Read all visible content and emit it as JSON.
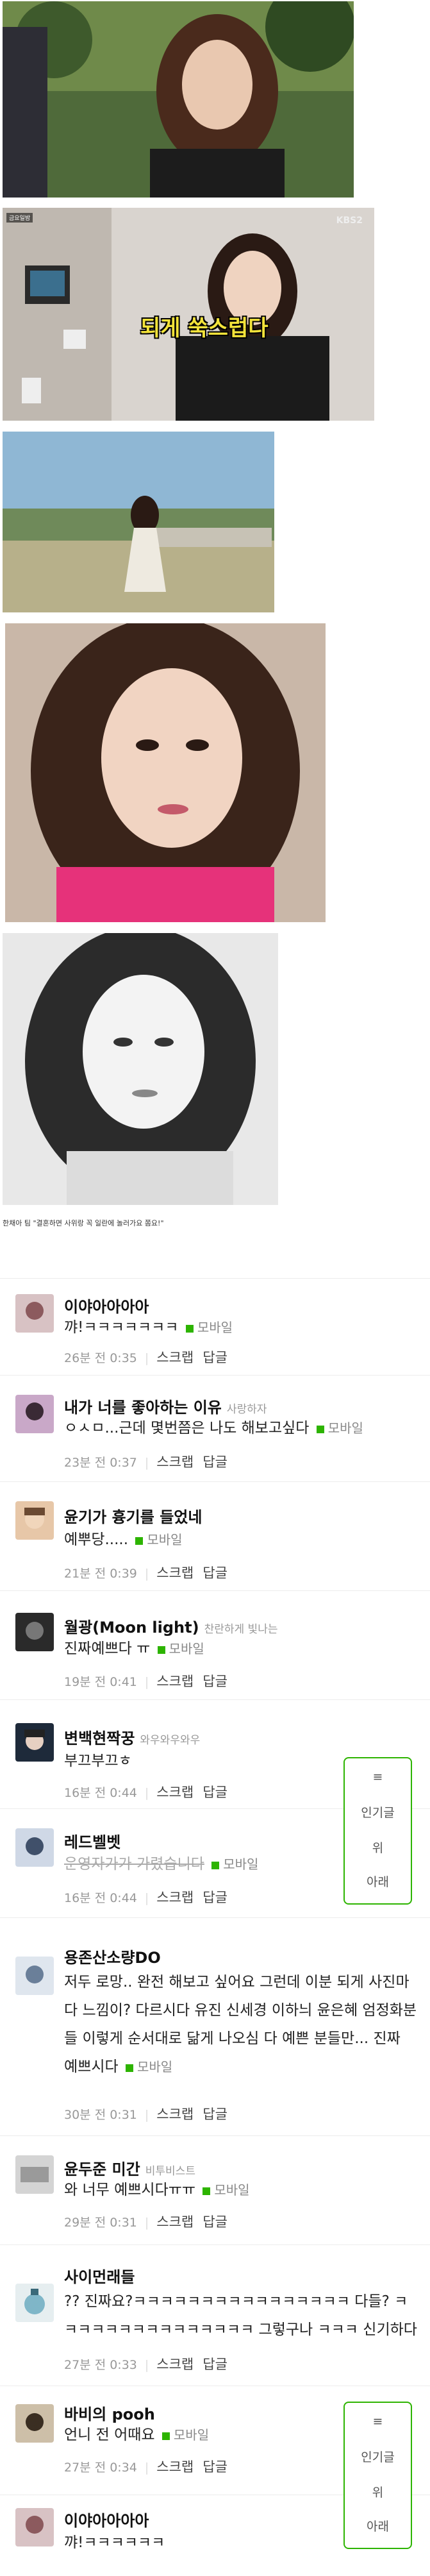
{
  "photos": {
    "kbs_tag": "KBS2",
    "tv_badge": "금요일밤",
    "overlay": "되게 쑥스럽다",
    "caption": "한채아 팀 \"결혼하면 사위랑 꼭 일란에 놀러가요 쫌요!\""
  },
  "comments": [
    {
      "nick": "이야아아아아",
      "sub": "",
      "body": "꺄!ㅋㅋㅋㅋㅋㅋㅋ",
      "mobile": "모바일",
      "time": "26분 전 0:35",
      "scrap": "스크랩",
      "reply": "답글"
    },
    {
      "nick": "내가 너를 좋아하는 이유",
      "sub": "사랑하자",
      "body": "ㅇㅅㅁ...근데 몇번쯤은 나도 해보고싶다",
      "mobile": "모바일",
      "time": "23분 전 0:37",
      "scrap": "스크랩",
      "reply": "답글"
    },
    {
      "nick": "윤기가 흉기를 들었네",
      "sub": "",
      "body": "예뿌당.....",
      "mobile": "모바일",
      "time": "21분 전 0:39",
      "scrap": "스크랩",
      "reply": "답글"
    },
    {
      "nick": "월광(Moon light)",
      "sub": "찬란하게 빛나는",
      "body": "진짜예쁘다 ㅠ",
      "mobile": "모바일",
      "time": "19분 전 0:41",
      "scrap": "스크랩",
      "reply": "답글"
    },
    {
      "nick": "변백현짝꿍",
      "sub": "와우와우와우",
      "body": "부끄부끄ㅎ",
      "mobile": "",
      "time": "16분 전 0:44",
      "scrap": "스크랩",
      "reply": "답글"
    },
    {
      "nick": "레드벨벳",
      "sub": "",
      "body": "운영자가가 가렸습니다",
      "mobile": "모바일",
      "time": "16분 전 0:44",
      "scrap": "스크랩",
      "reply": "답글"
    },
    {
      "nick": "용존산소량DO",
      "sub": "",
      "body": "저두 로망.. 완전 해보고 싶어요 그런데 이분 되게 사진마다 느낌이? 다르시다 유진 신세경 이하늬 윤은혜 엄정화분들 이렇게 순서대로 닮게 나오심 다 예쁜 분들만... 진짜 예쁘시다",
      "mobile": "모바일",
      "time": "30분 전 0:31",
      "scrap": "스크랩",
      "reply": "답글"
    },
    {
      "nick": "윤두준 미간",
      "sub": "비투비스트",
      "body": "와 너무 예쁘시다ㅠㅠ",
      "mobile": "모바일",
      "time": "29분 전 0:31",
      "scrap": "스크랩",
      "reply": "답글"
    },
    {
      "nick": "사이먼래들",
      "sub": "",
      "body": "?? 진짜요?ㅋㅋㅋㅋㅋㅋㅋㅋㅋㅋㅋㅋㅋㅋㅋㅋ 다들? ㅋㅋㅋㅋㅋㅋㅋㅋㅋㅋㅋㅋㅋㅋㅋ 그렇구나 ㅋㅋㅋ 신기하다",
      "mobile": "",
      "time": "27분 전 0:33",
      "scrap": "스크랩",
      "reply": "답글"
    },
    {
      "nick": "바비의 pooh",
      "sub": "",
      "body": "언니 전 어때요",
      "mobile": "모바일",
      "time": "27분 전 0:34",
      "scrap": "스크랩",
      "reply": "답글"
    },
    {
      "nick": "이야아아아아",
      "sub": "",
      "body": "꺄!ㅋㅋㅋㅋㅋㅋ",
      "mobile": "",
      "time": "",
      "scrap": "",
      "reply": ""
    }
  ],
  "float_nav": {
    "top": "≡",
    "popular": "인기글",
    "up": "위",
    "down": "아래"
  },
  "colors": {
    "accent": "#2db400"
  }
}
